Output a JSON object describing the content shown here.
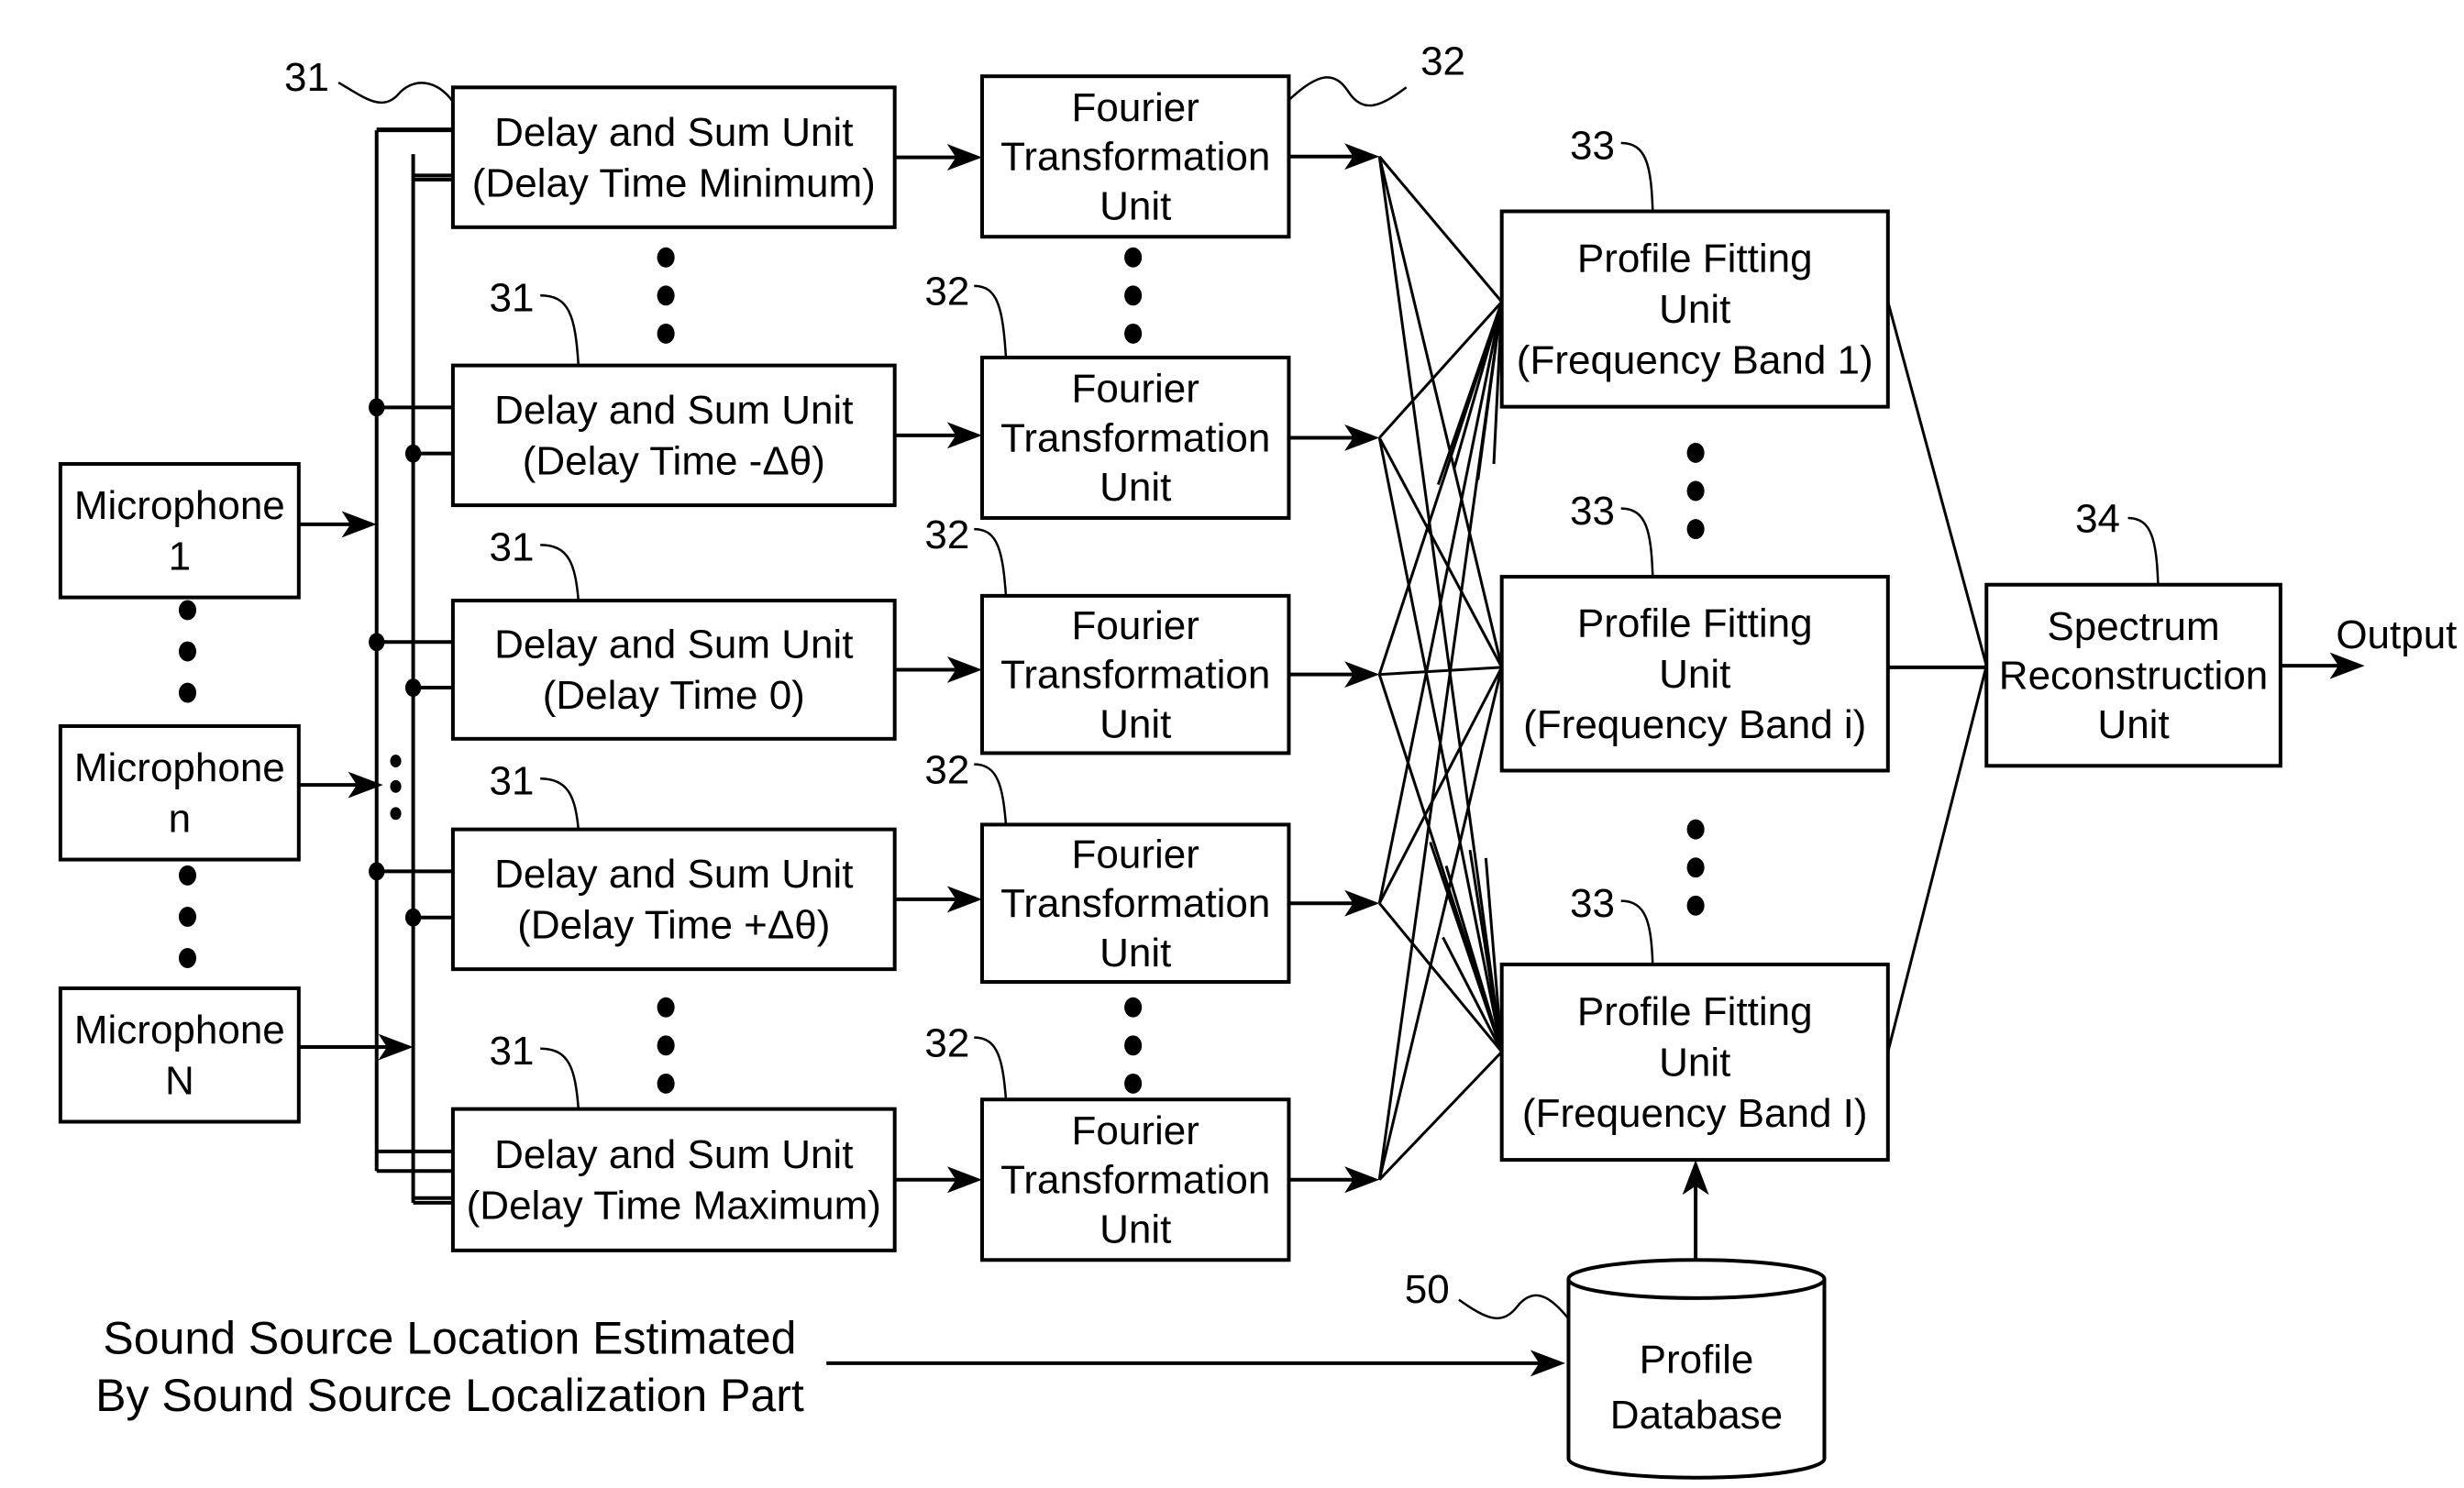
{
  "figure": {
    "microphones": [
      {
        "ref": "",
        "lines": [
          "Microphone",
          "1"
        ]
      },
      {
        "ref": "",
        "lines": [
          "Microphone",
          "n"
        ]
      },
      {
        "ref": "",
        "lines": [
          "Microphone",
          "N"
        ]
      }
    ],
    "delay_sum_units": [
      {
        "ref": "31",
        "lines": [
          "Delay and Sum Unit",
          "(Delay Time Minimum)"
        ]
      },
      {
        "ref": "31",
        "lines": [
          "Delay and Sum Unit",
          "(Delay Time -Δθ)"
        ]
      },
      {
        "ref": "31",
        "lines": [
          "Delay and Sum Unit",
          "(Delay Time 0)"
        ]
      },
      {
        "ref": "31",
        "lines": [
          "Delay and Sum Unit",
          "(Delay Time +Δθ)"
        ]
      },
      {
        "ref": "31",
        "lines": [
          "Delay and Sum Unit",
          "(Delay Time Maximum)"
        ]
      }
    ],
    "fourier_units": [
      {
        "ref": "32",
        "lines": [
          "Fourier",
          "Transformation",
          "Unit"
        ]
      },
      {
        "ref": "32",
        "lines": [
          "Fourier",
          "Transformation",
          "Unit"
        ]
      },
      {
        "ref": "32",
        "lines": [
          "Fourier",
          "Transformation",
          "Unit"
        ]
      },
      {
        "ref": "32",
        "lines": [
          "Fourier",
          "Transformation",
          "Unit"
        ]
      },
      {
        "ref": "32",
        "lines": [
          "Fourier",
          "Transformation",
          "Unit"
        ]
      }
    ],
    "profile_fitting_units": [
      {
        "ref": "33",
        "lines": [
          "Profile Fitting",
          "Unit",
          "(Frequency Band 1)"
        ]
      },
      {
        "ref": "33",
        "lines": [
          "Profile Fitting",
          "Unit",
          "(Frequency Band i)"
        ]
      },
      {
        "ref": "33",
        "lines": [
          "Profile Fitting",
          "Unit",
          "(Frequency Band I)"
        ]
      }
    ],
    "spectrum_unit": {
      "ref": "34",
      "lines": [
        "Spectrum",
        "Reconstruction",
        "Unit"
      ]
    },
    "output_label": "Output",
    "profile_database": {
      "ref": "50",
      "lines": [
        "Profile",
        "Database"
      ]
    },
    "source_location_note": [
      "Sound Source Location Estimated",
      "By Sound Source Localization Part"
    ]
  }
}
